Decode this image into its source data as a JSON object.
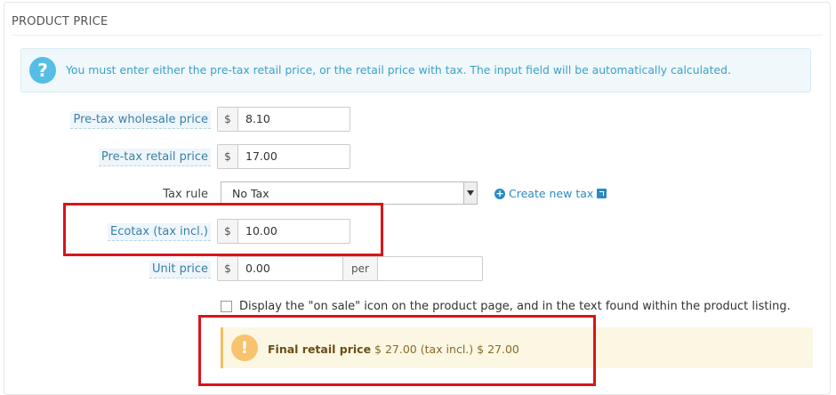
{
  "section": {
    "title": "PRODUCT PRICE"
  },
  "info": {
    "icon": "question-icon",
    "text": "You must enter either the pre-tax retail price, or the retail price with tax. The input field will be automatically calculated."
  },
  "fields": {
    "wholesale": {
      "label": "Pre-tax wholesale price",
      "currency": "$",
      "value": "8.10"
    },
    "retail": {
      "label": "Pre-tax retail price",
      "currency": "$",
      "value": "17.00"
    },
    "tax_rule": {
      "label": "Tax rule",
      "selected": "No Tax",
      "create_link": "Create new tax"
    },
    "ecotax": {
      "label": "Ecotax (tax incl.)",
      "currency": "$",
      "value": "10.00"
    },
    "unit_price": {
      "label": "Unit price",
      "currency": "$",
      "value": "0.00",
      "per_label": "per",
      "per_value": ""
    }
  },
  "on_sale": {
    "label": "Display the \"on sale\" icon on the product page, and in the text found within the product listing.",
    "checked": false
  },
  "final_price": {
    "icon": "exclamation-icon",
    "label": "Final retail price",
    "value": "$ 27.00",
    "incl_label": "(tax incl.)",
    "incl_value": "$ 27.00"
  },
  "colors": {
    "highlight": "#d9141b",
    "info": "#56bde6",
    "warning": "#f7c36d",
    "link": "#2c8bc0"
  }
}
